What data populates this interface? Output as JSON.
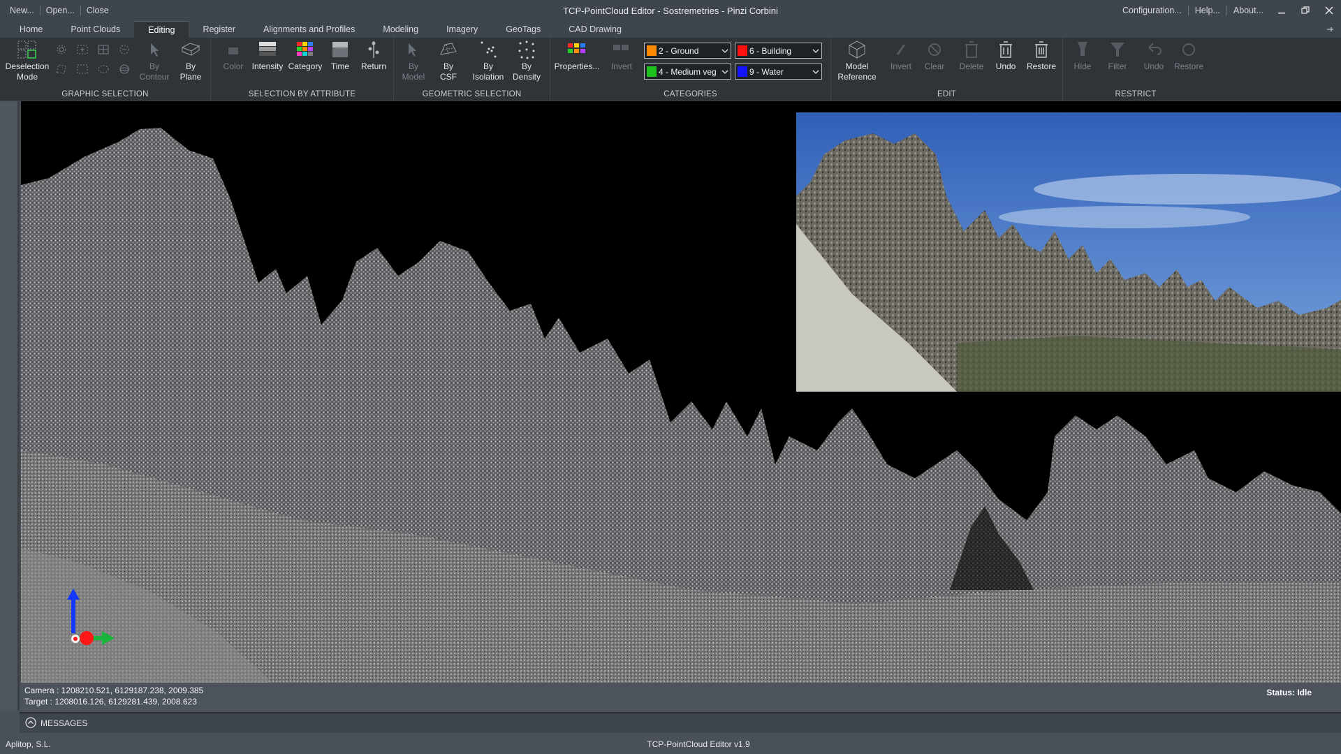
{
  "window": {
    "title": "TCP-PointCloud Editor - Sostremetries - Pinzi Corbini",
    "quick_actions": [
      "New...",
      "Open...",
      "Close"
    ],
    "right_menu": [
      "Configuration...",
      "Help...",
      "About..."
    ]
  },
  "tabs": [
    "Home",
    "Point Clouds",
    "Editing",
    "Register",
    "Alignments and Profiles",
    "Modeling",
    "Imagery",
    "GeoTags",
    "CAD Drawing"
  ],
  "active_tab": "Editing",
  "ribbon": {
    "graphic_selection": {
      "label": "GRAPHIC SELECTION",
      "deselection_mode": "Deselection\nMode",
      "by_contour": "By\nContour",
      "by_plane": "By\nPlane"
    },
    "selection_by_attribute": {
      "label": "SELECTION BY ATTRIBUTE",
      "color": "Color",
      "intensity": "Intensity",
      "category": "Category",
      "time": "Time",
      "return": "Return"
    },
    "geometric_selection": {
      "label": "GEOMETRIC SELECTION",
      "by_model": "By\nModel",
      "by_csf": "By\nCSF",
      "by_isolation": "By\nIsolation",
      "by_density": "By\nDensity"
    },
    "categories": {
      "label": "CATEGORIES",
      "properties": "Properties...",
      "invert": "Invert",
      "cat1": {
        "text": "2 - Ground",
        "color": "#ff8a00"
      },
      "cat2": {
        "text": "6 - Building",
        "color": "#ff1010"
      },
      "cat3": {
        "text": "4 - Medium veg",
        "color": "#1ec21e"
      },
      "cat4": {
        "text": "9 - Water",
        "color": "#1414ff"
      }
    },
    "edit": {
      "label": "EDIT",
      "model_reference": "Model\nReference",
      "invert": "Invert",
      "clear": "Clear",
      "delete": "Delete",
      "undo": "Undo",
      "restore": "Restore"
    },
    "restrict": {
      "label": "RESTRICT",
      "hide": "Hide",
      "filter": "Filter",
      "undo": "Undo",
      "restore": "Restore"
    }
  },
  "viewport": {
    "camera": "Camera : 1208210.521, 6129187.238, 2009.385",
    "target": "Target : 1208016.126, 6129281.439, 2008.623",
    "status": "Status: Idle"
  },
  "messages_label": "MESSAGES",
  "footer": {
    "company": "Aplitop, S.L.",
    "version": "TCP-PointCloud Editor v1.9"
  }
}
